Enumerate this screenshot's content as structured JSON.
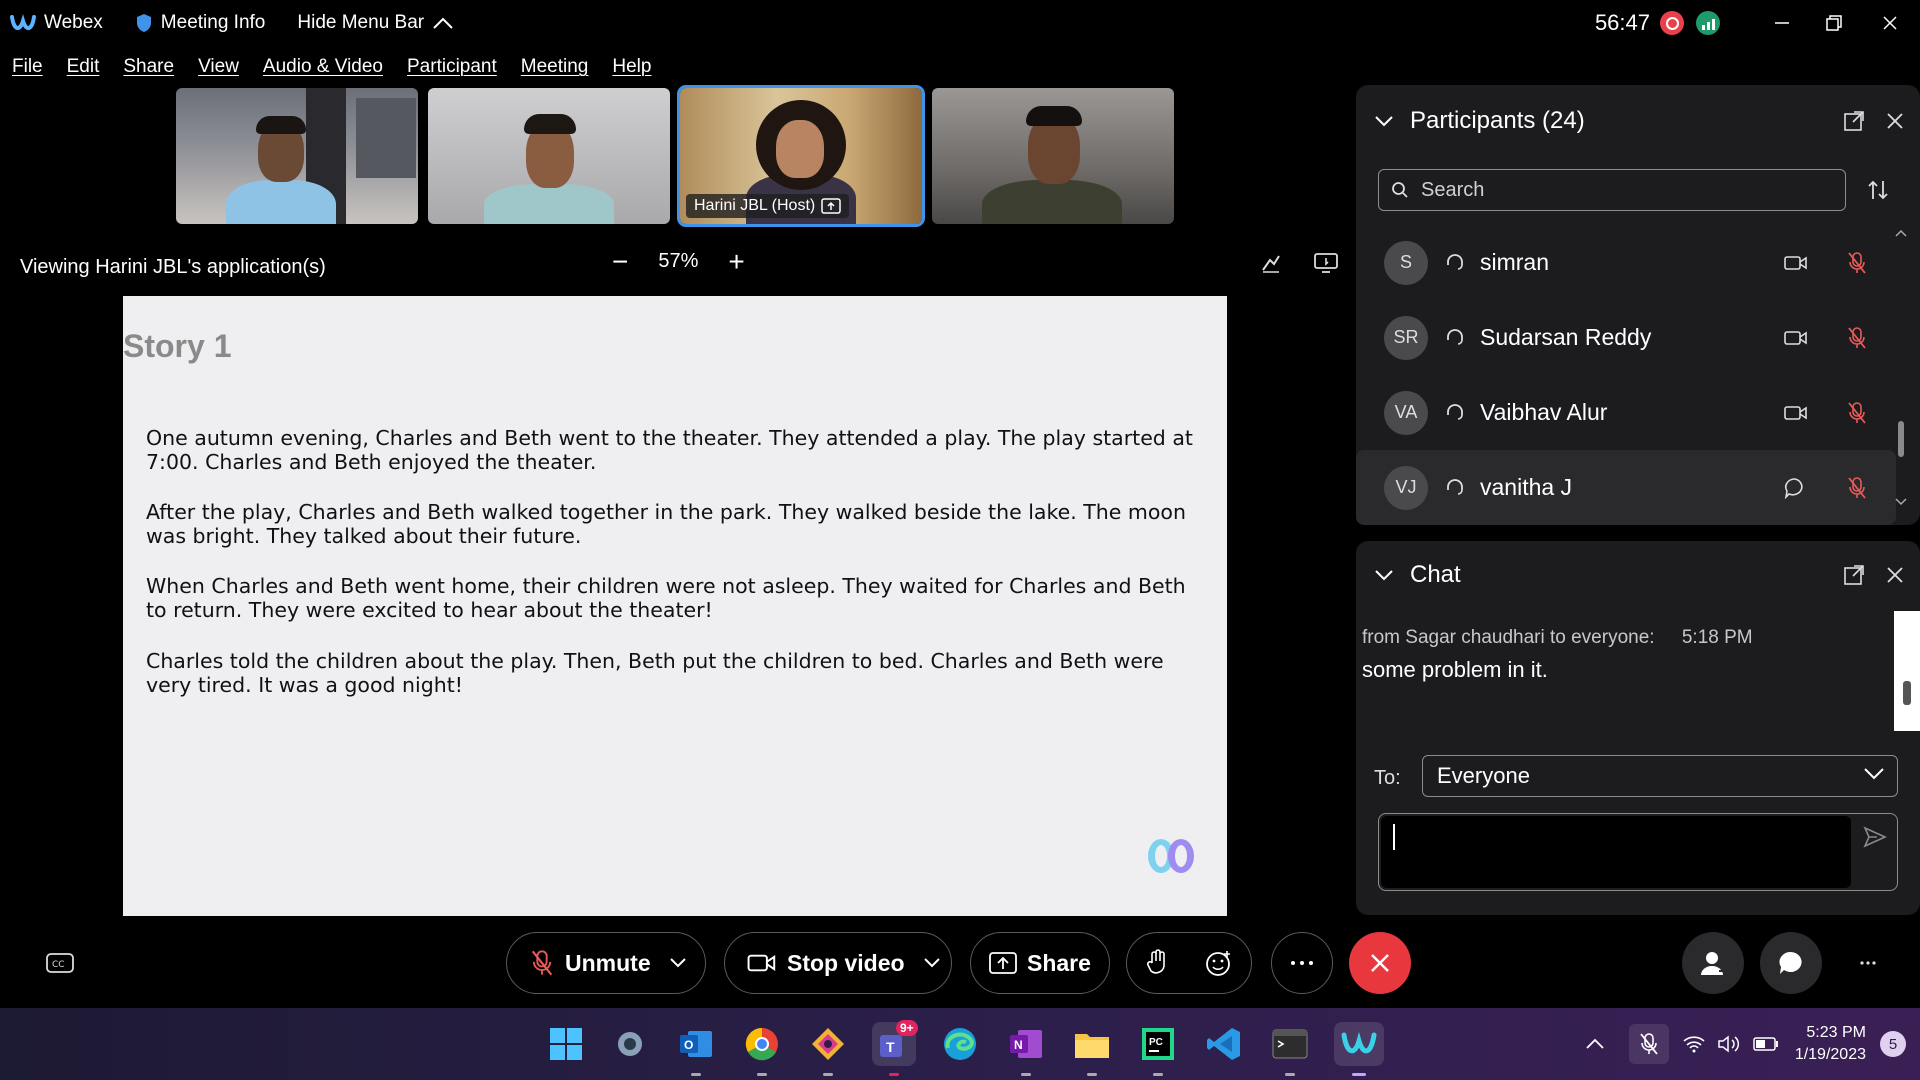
{
  "titlebar": {
    "app_name": "Webex",
    "meeting_info": "Meeting Info",
    "hide_menu_bar": "Hide Menu Bar",
    "timer": "56:47"
  },
  "menu": [
    "File",
    "Edit",
    "Share",
    "View",
    "Audio & Video",
    "Participant",
    "Meeting",
    "Help"
  ],
  "thumbnails": [
    {
      "label": ""
    },
    {
      "label": ""
    },
    {
      "label": "Harini JBL (Host)",
      "active": true
    },
    {
      "label": ""
    }
  ],
  "viewing": {
    "text": "Viewing Harini JBL's application(s)",
    "zoom": "57%"
  },
  "shared": {
    "title": "Story 1",
    "paragraphs": [
      "One autumn evening, Charles and Beth went to the theater. They attended a play. The play started at 7:00. Charles and Beth enjoyed the theater.",
      "After the play, Charles and Beth walked together in the park. They walked beside the lake. The moon was bright. They talked about their future.",
      "When Charles and Beth went home, their children were not asleep. They waited for Charles and Beth to return. They were excited to hear about the theater!",
      "Charles told the children about the play. Then, Beth put the children to bed. Charles and Beth were very tired. It was a good night!"
    ]
  },
  "participants": {
    "title": "Participants (24)",
    "search_placeholder": "Search",
    "list": [
      {
        "initials": "S",
        "name": "simran",
        "icon": "video-icon"
      },
      {
        "initials": "SR",
        "name": "Sudarsan Reddy",
        "icon": "video-icon"
      },
      {
        "initials": "VA",
        "name": "Vaibhav Alur",
        "icon": "video-icon"
      },
      {
        "initials": "VJ",
        "name": "vanitha J",
        "icon": "chat-icon"
      }
    ]
  },
  "chat": {
    "title": "Chat",
    "message_from": "from Sagar chaudhari to everyone:",
    "message_time": "5:18 PM",
    "message_text": "some problem in it.",
    "to_label": "To:",
    "to_value": "Everyone"
  },
  "controls": {
    "unmute": "Unmute",
    "stop_video": "Stop video",
    "share": "Share"
  },
  "taskbar": {
    "time": "5:23 PM",
    "date": "1/19/2023",
    "notifications": "5",
    "teams_badge": "9+"
  },
  "colors": {
    "accent": "#3f93e8",
    "end_call": "#e8383d",
    "panel": "#1c1c1e"
  }
}
